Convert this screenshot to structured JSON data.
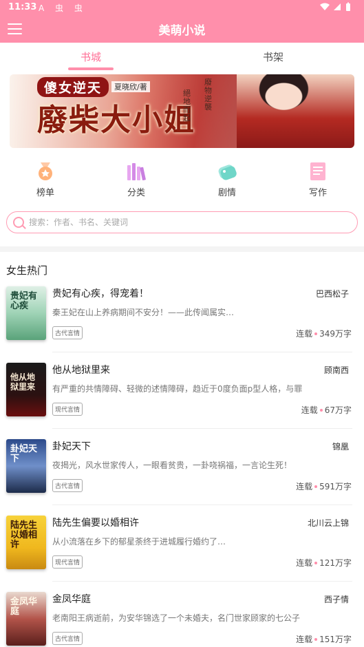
{
  "status_bar": {
    "time": "11:33",
    "notif_icons": "A 虫 虫",
    "right_icons": "▾◢▮"
  },
  "app": {
    "title": "美萌小说"
  },
  "tabs": [
    {
      "label": "书城",
      "active": true
    },
    {
      "label": "书架",
      "active": false
    }
  ],
  "banner": {
    "tagline": "傻女逆天",
    "author": "夏晓欣/著",
    "title": "廢柴大小姐",
    "vertical_1": "絕地而起",
    "vertical_2": "廢物逆襲",
    "page_count": 3,
    "active_page": 1
  },
  "quick_nav": [
    {
      "label": "榜单",
      "icon": "medal-icon"
    },
    {
      "label": "分类",
      "icon": "books-icon"
    },
    {
      "label": "剧情",
      "icon": "tags-icon"
    },
    {
      "label": "写作",
      "icon": "notebook-icon"
    }
  ],
  "search": {
    "placeholder": "搜索：作者、书名、关键词"
  },
  "section": {
    "title": "女生热门"
  },
  "books": [
    {
      "title": "贵妃有心疾，得宠着！",
      "author": "巴西松子",
      "desc": "秦王妃在山上养病期间不安分！——此传闻属实…",
      "genre": "古代言情",
      "status": "连载",
      "words": "349万字",
      "cover_text": "贵妃有心疾"
    },
    {
      "title": "他从地狱里来",
      "author": "顾南西",
      "desc": "有严重的共情障碍、轻微的述情障碍，趋近于0度负面p型人格，与罪",
      "genre": "现代言情",
      "status": "连载",
      "words": "67万字",
      "cover_text": "他从地狱里来"
    },
    {
      "title": "卦妃天下",
      "author": "锦凰",
      "desc": "夜揭光，风水世家传人，一眼看贫贵，一卦哓祸福，一言论生死！",
      "genre": "古代言情",
      "status": "连载",
      "words": "591万字",
      "cover_text": "卦妃天下"
    },
    {
      "title": "陆先生偏要以婚相许",
      "author": "北川云上锦",
      "desc": "从小流落在乡下的郁星荼终于进城履行婚约了…",
      "genre": "现代言情",
      "status": "连载",
      "words": "121万字",
      "cover_text": "陆先生以婚相许"
    },
    {
      "title": "金凤华庭",
      "author": "西子情",
      "desc": "老南阳王病逝前，为安华锦选了一个未婚夫，名门世家顾家的七公子",
      "genre": "古代言情",
      "status": "连载",
      "words": "151万字",
      "cover_text": "金凤华庭"
    }
  ],
  "colors": {
    "accent": "#ff8fab",
    "accent_text": "#ff6f96"
  }
}
